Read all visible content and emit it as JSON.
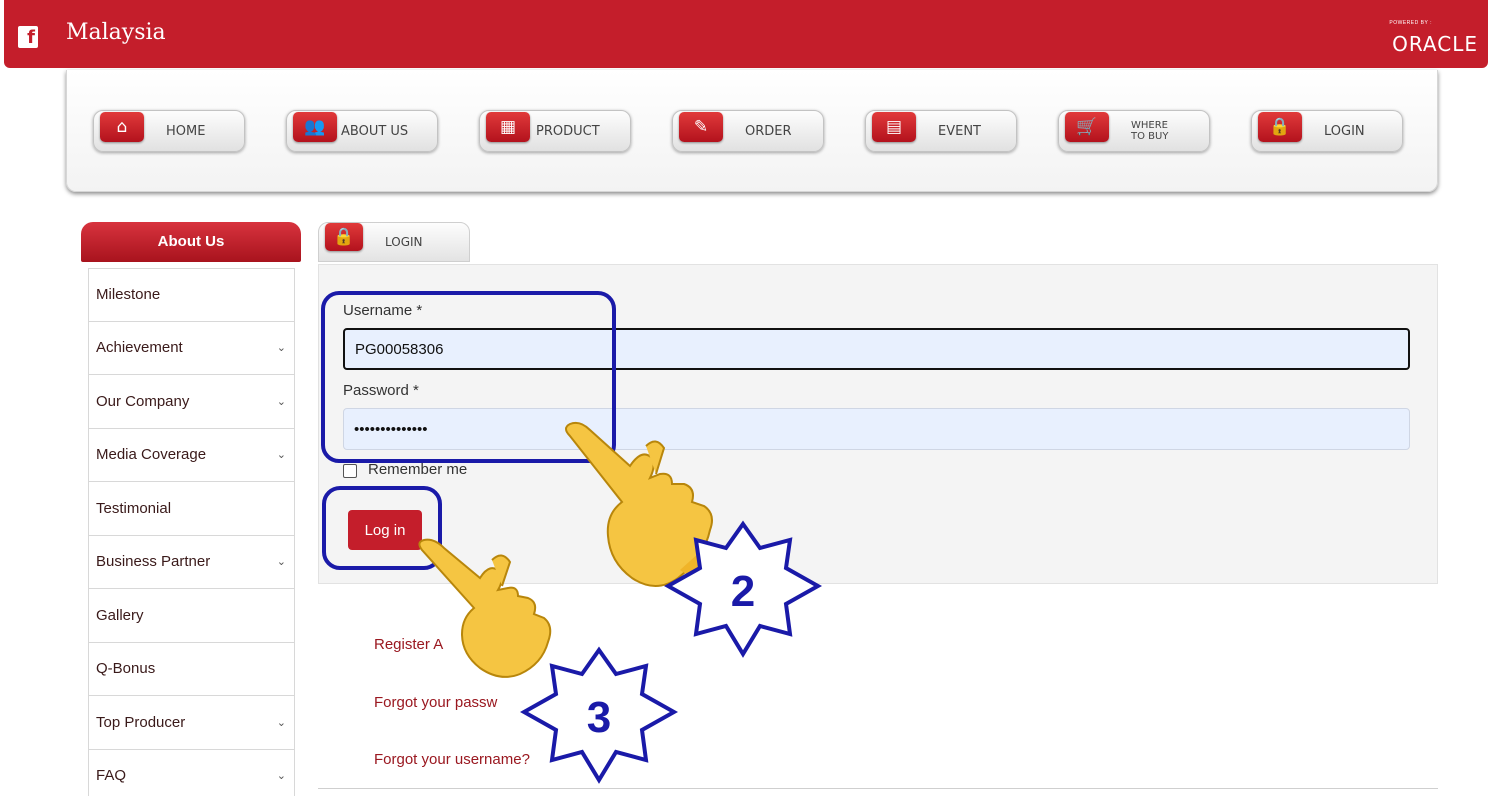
{
  "header": {
    "fb_glyph": "f",
    "brand": "Malaysia",
    "powered_by": "POWERED BY :",
    "oracle": "ORACLE"
  },
  "nav": {
    "items": [
      {
        "label": "HOME",
        "icon": "home-icon"
      },
      {
        "label": "ABOUT US",
        "icon": "people-icon"
      },
      {
        "label": "PRODUCT",
        "icon": "gift-icon"
      },
      {
        "label": "ORDER",
        "icon": "order-form-icon"
      },
      {
        "label": "EVENT",
        "icon": "calendar-icon"
      },
      {
        "label": "WHERE\nTO BUY",
        "icon": "cart-icon"
      },
      {
        "label": "LOGIN",
        "icon": "lock-icon"
      }
    ]
  },
  "sidebar": {
    "heading": "About Us",
    "items": [
      {
        "label": "Milestone",
        "has_chevron": false
      },
      {
        "label": "Achievement",
        "has_chevron": true
      },
      {
        "label": "Our Company",
        "has_chevron": true
      },
      {
        "label": "Media Coverage",
        "has_chevron": true
      },
      {
        "label": "Testimonial",
        "has_chevron": false
      },
      {
        "label": "Business Partner",
        "has_chevron": true
      },
      {
        "label": "Gallery",
        "has_chevron": false
      },
      {
        "label": "Q-Bonus",
        "has_chevron": false
      },
      {
        "label": "Top Producer",
        "has_chevron": true
      },
      {
        "label": "FAQ",
        "has_chevron": true
      }
    ],
    "chevron_glyph": "⌄"
  },
  "login": {
    "tab_label": "LOGIN",
    "username_label": "Username *",
    "username_value": "PG00058306",
    "password_label": "Password *",
    "password_value": "••••••••••••••",
    "remember_label": "Remember me",
    "submit_label": "Log in"
  },
  "links": {
    "register": "Register A",
    "forgot_password": "Forgot your passw",
    "forgot_username": "Forgot your username?"
  },
  "annotations": {
    "step_2": "2",
    "step_3": "3"
  },
  "colors": {
    "brand_red": "#c41e2b",
    "annotation_blue": "#1a1aa8",
    "autofill_blue": "#e8f0fe",
    "link_red": "#9a1820"
  }
}
